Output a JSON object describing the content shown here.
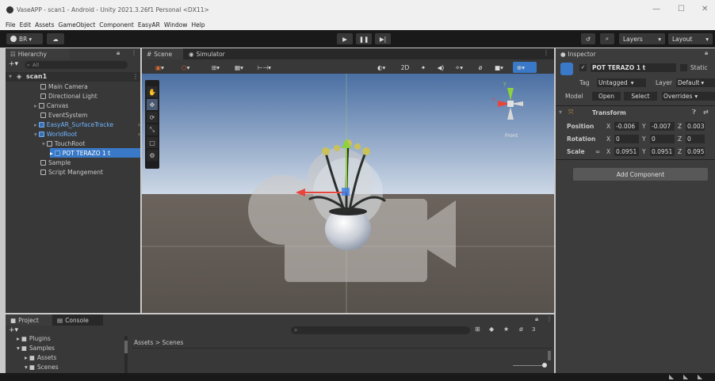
{
  "window": {
    "title": "VaseAPP - scan1 - Android - Unity 2021.3.26f1 Personal <DX11>",
    "minimize": "—",
    "maximize": "☐",
    "close": "✕"
  },
  "menu": [
    "File",
    "Edit",
    "Assets",
    "GameObject",
    "Component",
    "EasyAR",
    "Window",
    "Help"
  ],
  "toolbar": {
    "account": "BR",
    "layers": "Layers",
    "layout": "Layout"
  },
  "hierarchy": {
    "tab": "Hierarchy",
    "search": "All",
    "items": [
      {
        "label": "scan1",
        "indent": 0,
        "type": "scene"
      },
      {
        "label": "Main Camera",
        "indent": 1,
        "type": "obj"
      },
      {
        "label": "Directional Light",
        "indent": 1,
        "type": "obj"
      },
      {
        "label": "Canvas",
        "indent": 1,
        "type": "obj"
      },
      {
        "label": "EventSystem",
        "indent": 1,
        "type": "obj"
      },
      {
        "label": "EasyAR_SurfaceTracke",
        "indent": 1,
        "type": "prefab"
      },
      {
        "label": "WorldRoot",
        "indent": 1,
        "type": "prefab"
      },
      {
        "label": "TouchRoot",
        "indent": 2,
        "type": "obj"
      },
      {
        "label": "POT TERAZO 1 t",
        "indent": 3,
        "type": "prefab",
        "selected": true
      },
      {
        "label": "Sample",
        "indent": 1,
        "type": "obj"
      },
      {
        "label": "Script Mangement",
        "indent": 1,
        "type": "obj"
      }
    ]
  },
  "scene": {
    "tab_scene": "Scene",
    "tab_sim": "Simulator",
    "view_2d": "2D",
    "front": "Front",
    "tools": [
      "✋",
      "✥",
      "⟳",
      "⤡",
      "▢",
      "⚙"
    ]
  },
  "inspector": {
    "tab": "Inspector",
    "object": "POT TERAZO 1 t",
    "static": "Static",
    "tag_label": "Tag",
    "tag": "Untagged",
    "layer_label": "Layer",
    "layer": "Default",
    "model": "Model",
    "open": "Open",
    "select": "Select",
    "overrides": "Overrides",
    "transform": "Transform",
    "rows": [
      {
        "label": "Position",
        "x": "-0.006",
        "y": "-0.007",
        "z": "0.003"
      },
      {
        "label": "Rotation",
        "x": "0",
        "y": "0",
        "z": "0"
      },
      {
        "label": "Scale",
        "x": "0.0951",
        "y": "0.0951",
        "z": "0.095"
      }
    ],
    "add_component": "Add Component"
  },
  "project": {
    "tab_project": "Project",
    "tab_console": "Console",
    "count": "3",
    "breadcrumb": "Assets > Scenes",
    "tree": [
      {
        "label": "Plugins",
        "indent": 1
      },
      {
        "label": "Samples",
        "indent": 1
      },
      {
        "label": "Assets",
        "indent": 2
      },
      {
        "label": "Scenes",
        "indent": 2
      }
    ]
  },
  "colors": {
    "accent": "#3a79c7",
    "axis_x": "#e8453c",
    "axis_y": "#8ed13e",
    "axis_z": "#3b7be8"
  }
}
